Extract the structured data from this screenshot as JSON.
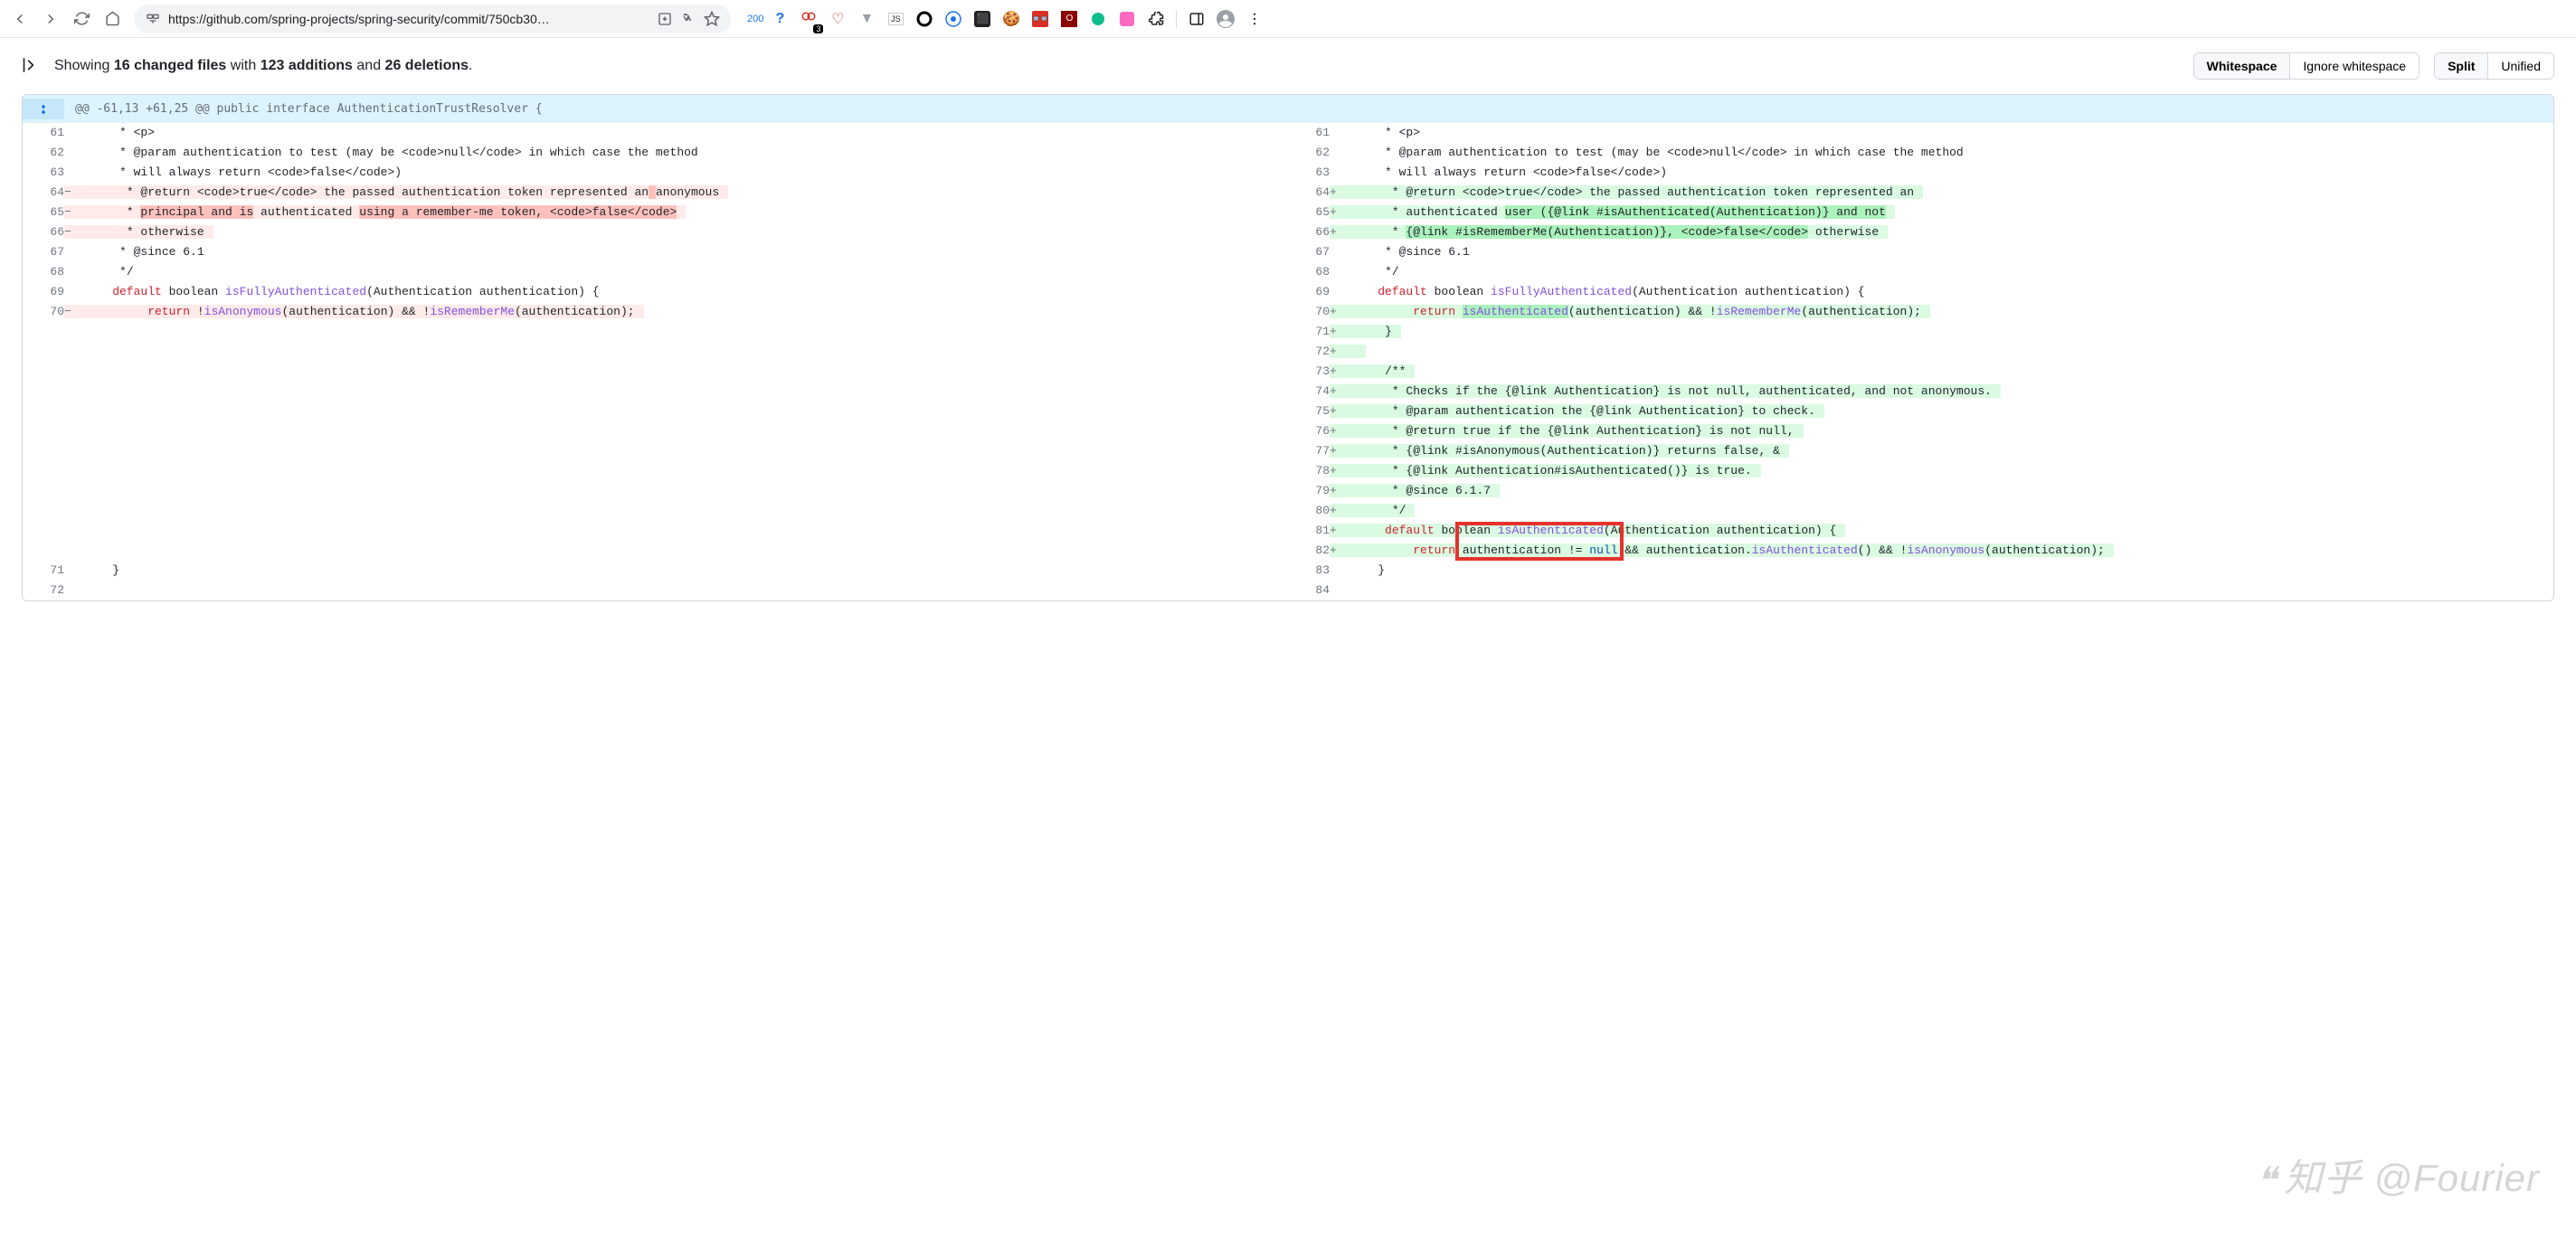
{
  "browser": {
    "url": "https://github.com/spring-projects/spring-security/commit/750cb30…",
    "badge": "200",
    "notif_count": "3"
  },
  "toolbar": {
    "showing": "Showing",
    "files": "16 changed files",
    "with": "with",
    "additions": "123 additions",
    "and": "and",
    "deletions": "26 deletions",
    "period": ".",
    "whitespace": "Whitespace",
    "ignore_ws": "Ignore whitespace",
    "split": "Split",
    "unified": "Unified"
  },
  "hunk": "@@ -61,13 +61,25 @@ public interface AuthenticationTrustResolver {",
  "lines": {
    "l61": "     * <p>",
    "l62": "     * @param authentication to test (may be <code>null</code> in which case the method",
    "l63": "     * will always return <code>false</code>)",
    "l64_del_a": "     * @return <code>true</code> the passed authentication token represented an",
    "l64_del_hl": " ",
    "l64_del_b": "anonymous",
    "l64_add_a": "     * @return <code>true</code> the passed authentication token represented an",
    "l65_del_a": "     * ",
    "l65_del_hl1": "principal and is",
    "l65_del_mid": " authenticated ",
    "l65_del_hl2": "using a remember-me token, <code>false</code>",
    "l65_add_a": "     * authenticated ",
    "l65_add_hl": "user ({@link #isAuthenticated(Authentication)} and not",
    "l66_del": "     * otherwise",
    "l66_add_a": "     * ",
    "l66_add_hl": "{@link #isRememberMe(Authentication)}, <code>false</code>",
    "l66_add_b": " otherwise",
    "l67": "     * @since 6.1",
    "l68": "     */",
    "l69_pre": "    ",
    "l69_def": "default",
    "l69_mid": " boolean ",
    "l69_fn": "isFullyAuthenticated",
    "l69_post": "(Authentication authentication) {",
    "l70_del_pre": "        ",
    "l70_del_ret": "return",
    "l70_del_a": " !",
    "l70_del_fn1": "isAnonymous",
    "l70_del_b": "(authentication) && !",
    "l70_del_fn2": "isRememberMe",
    "l70_del_c": "(authentication);",
    "l70_add_pre": "        ",
    "l70_add_ret": "return",
    "l70_add_sp": " ",
    "l70_add_fn1": "isAuthenticated",
    "l70_add_b": "(authentication) && !",
    "l70_add_fn2": "isRememberMe",
    "l70_add_c": "(authentication);",
    "l71": "    }",
    "l72": "",
    "l73": "    /**",
    "l74": "     * Checks if the {@link Authentication} is not null, authenticated, and not anonymous.",
    "l75": "     * @param authentication the {@link Authentication} to check.",
    "l76": "     * @return true if the {@link Authentication} is not null,",
    "l77": "     * {@link #isAnonymous(Authentication)} returns false, &",
    "l78": "     * {@link Authentication#isAuthenticated()} is true.",
    "l79": "     * @since 6.1.7",
    "l80": "     */",
    "l81_pre": "    ",
    "l81_def": "default",
    "l81_mid": " boolean ",
    "l81_fn": "isAuthenticated",
    "l81_post": "(Authentication authentication) {",
    "l82_pre": "        ",
    "l82_ret": "return",
    "l82_sp": " ",
    "l82_box": "authentication != ",
    "l82_null": "null",
    "l82_mid": " && authentication.",
    "l82_fn": "isAuthenticated",
    "l82_post": "() && !",
    "l82_fn2": "isAnonymous",
    "l82_end": "(authentication);",
    "l83": "    }",
    "l84": ""
  },
  "ln": {
    "61": "61",
    "62": "62",
    "63": "63",
    "64": "64",
    "65": "65",
    "66": "66",
    "67": "67",
    "68": "68",
    "69": "69",
    "70": "70",
    "71": "71",
    "72": "72",
    "73": "73",
    "74": "74",
    "75": "75",
    "76": "76",
    "77": "77",
    "78": "78",
    "79": "79",
    "80": "80",
    "81": "81",
    "82": "82",
    "83": "83",
    "84": "84"
  },
  "markers": {
    "minus": "−",
    "plus": "+"
  },
  "watermark": "知乎 @Fourier"
}
